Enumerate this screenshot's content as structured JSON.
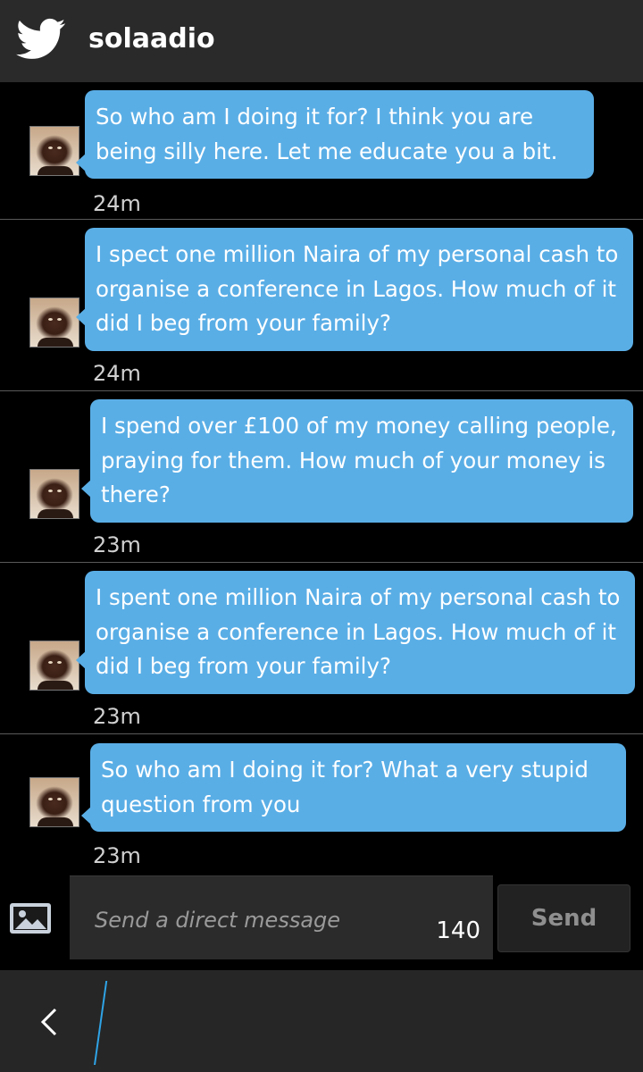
{
  "header": {
    "title": "solaadio",
    "logo_icon": "twitter-bird-icon"
  },
  "messages": [
    {
      "text": "So who am I doing it for? I think you are being silly here. Let me educate you a bit.",
      "time": "24m"
    },
    {
      "text": "I spect one million Naira of my personal cash to organise a conference in Lagos. How much of it did I beg from your family?",
      "time": "24m"
    },
    {
      "text": "I spend over £100 of my money calling people, praying for them. How much of your money is there?",
      "time": "23m"
    },
    {
      "text": "I spent one million Naira of my personal cash to organise a conference in Lagos. How much of it did I beg from your family?",
      "time": "23m"
    },
    {
      "text": "So who am I doing it for? What a very stupid question from you",
      "time": "23m"
    }
  ],
  "composer": {
    "placeholder": "Send a direct message",
    "char_count": "140",
    "send_label": "Send",
    "image_icon": "image-attach-icon"
  },
  "footer": {
    "back_icon": "back-chevron-icon"
  },
  "colors": {
    "bubble": "#5aaee6",
    "header": "#2a2a2a",
    "accent": "#2fa4e7"
  }
}
